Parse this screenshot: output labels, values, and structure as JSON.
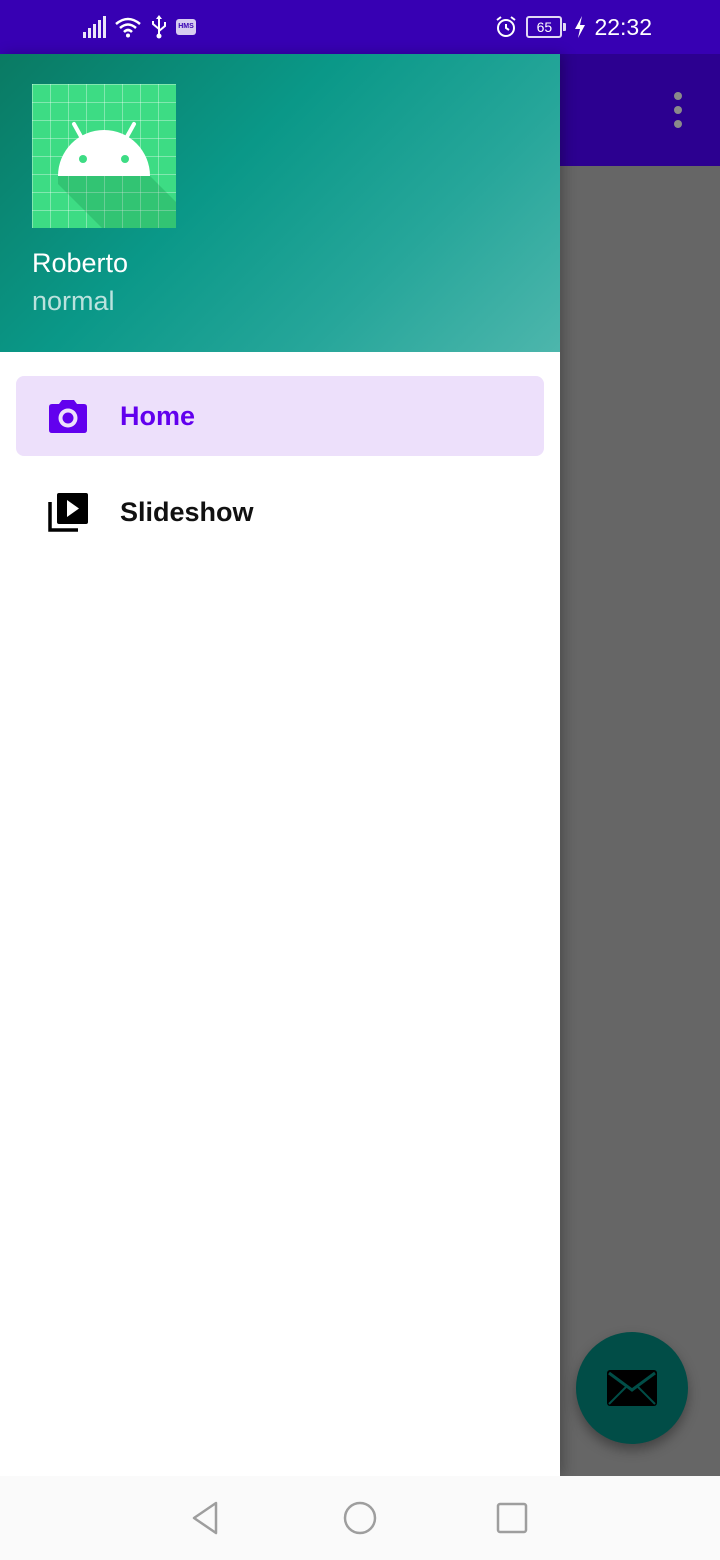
{
  "status_bar": {
    "time": "22:32",
    "battery_level": "65",
    "hms_badge": "HMS",
    "icons": [
      "signal-icon",
      "wifi-icon",
      "usb-icon",
      "hms-icon",
      "alarm-icon",
      "battery-icon",
      "charging-icon"
    ],
    "background_color": "#3700B3"
  },
  "app_bar": {
    "overflow_icon": "more-vert-icon",
    "background_color": "#2c0090"
  },
  "drawer": {
    "header": {
      "name": "Roberto",
      "subtitle": "normal",
      "avatar_icon": "android-icon"
    },
    "items": [
      {
        "label": "Home",
        "icon": "camera-icon",
        "selected": true
      },
      {
        "label": "Slideshow",
        "icon": "slideshow-icon",
        "selected": false
      }
    ],
    "accent_color": "#6200EE",
    "selected_bg_color": "#ede0fb"
  },
  "fab": {
    "icon": "mail-icon",
    "color": "#014d47"
  },
  "system_nav": {
    "buttons": [
      "back-icon",
      "home-circle-icon",
      "recents-icon"
    ]
  }
}
